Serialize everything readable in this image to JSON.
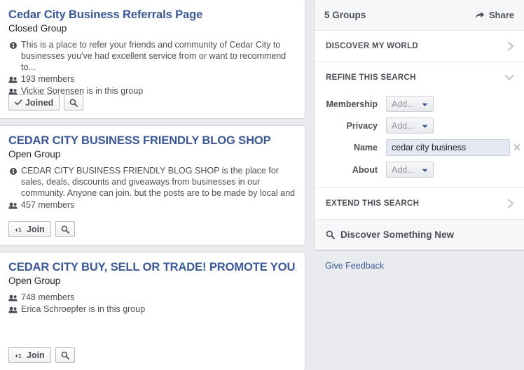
{
  "results": {
    "groups": [
      {
        "title": "Cedar City Business Referrals Page",
        "privacy": "Closed Group",
        "description": "This is a place to refer your friends and community of Cedar City to businesses you've had excellent service from or want to recommend to...",
        "members": "193 members",
        "friend_note": "Vickie Sorensen is in this group",
        "join_label": "Joined",
        "join_state": "joined",
        "join_icon": "check-icon",
        "search_icon": "search-icon"
      },
      {
        "title": "CEDAR CITY BUSINESS FRIENDLY BLOG SHOP",
        "privacy": "Open Group",
        "description": "CEDAR CITY BUSINESS FRIENDLY BLOG SHOP is the place for sales, deals, discounts and giveaways from businesses in our community. Anyone can join. but the posts are to be made by local and legitimate businesses or...",
        "members": "457 members",
        "friend_note": "",
        "join_label": "Join",
        "join_state": "not-joined",
        "join_icon": "add-friend-icon",
        "search_icon": "search-icon"
      },
      {
        "title": "CEDAR CITY BUY, SELL OR TRADE! PROMOTE YOU...",
        "privacy": "Open Group",
        "description": "",
        "members": "748 members",
        "friend_note": "Erica Schroepfer is in this group",
        "join_label": "Join",
        "join_state": "not-joined",
        "join_icon": "add-friend-icon",
        "search_icon": "search-icon"
      }
    ]
  },
  "sidebar": {
    "header": {
      "count_label": "5 Groups",
      "share_label": "Share",
      "share_icon": "share-arrow-icon"
    },
    "sections": [
      {
        "label": "DISCOVER MY WORLD",
        "state": "collapsed",
        "icon": "chevron-right-icon"
      },
      {
        "label": "REFINE THIS SEARCH",
        "state": "expanded",
        "icon": "chevron-down-icon"
      },
      {
        "label": "EXTEND THIS SEARCH",
        "state": "collapsed",
        "icon": "chevron-right-icon"
      }
    ],
    "filters": [
      {
        "label": "Membership",
        "type": "select",
        "value": "Add...",
        "icon": "caret-down-icon"
      },
      {
        "label": "Privacy",
        "type": "select",
        "value": "Add...",
        "icon": "caret-down-icon"
      },
      {
        "label": "Name",
        "type": "text",
        "value": "cedar city business",
        "placeholder": "",
        "clear_icon": "close-x-icon"
      },
      {
        "label": "About",
        "type": "select",
        "value": "Add...",
        "icon": "caret-down-icon"
      }
    ],
    "discover_new": {
      "label": "Discover Something New",
      "icon": "search-icon"
    },
    "feedback_label": "Give Feedback"
  },
  "colors": {
    "page_bg": "#e9ebee",
    "card_bg": "#ffffff",
    "link_blue": "#3b5998",
    "title_blue": "#3a5795",
    "text_dark": "#1d2129",
    "text_muted": "#4b4f56",
    "border": "#d3d6db",
    "input_bg": "#e4e8f0"
  }
}
